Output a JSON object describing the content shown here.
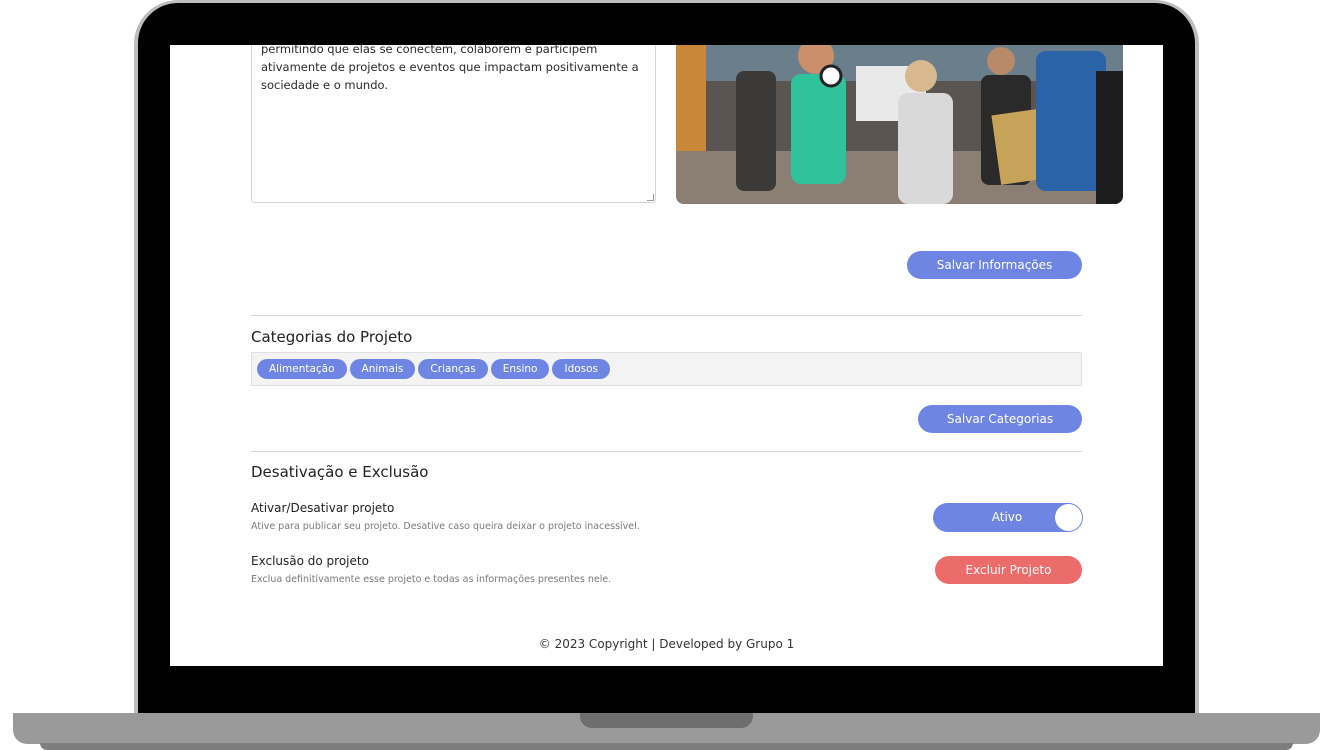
{
  "project": {
    "description": "permitindo que elas se conectem, colaborem e participem ativamente de projetos e eventos que impactam positivamente a sociedade e o mundo.",
    "save_info_label": "Salvar Informações"
  },
  "categories": {
    "title": "Categorias do Projeto",
    "items": [
      "Alimentação",
      "Animais",
      "Crianças",
      "Ensino",
      "Idosos"
    ],
    "save_label": "Salvar Categorias"
  },
  "deactivation": {
    "title": "Desativação e Exclusão",
    "toggle_title": "Ativar/Desativar projeto",
    "toggle_desc": "Ative para publicar seu projeto. Desative caso queira deixar o projeto inacessível.",
    "toggle_state": "Ativo",
    "delete_title": "Exclusão do projeto",
    "delete_desc": "Exclua definitivamente esse projeto e todas as informações presentes nele.",
    "delete_label": "Excluir Projeto"
  },
  "footer": {
    "text": "© 2023 Copyright | Developed by Grupo 1"
  },
  "colors": {
    "accent": "#6e85e4",
    "danger": "#ec6b6b"
  }
}
